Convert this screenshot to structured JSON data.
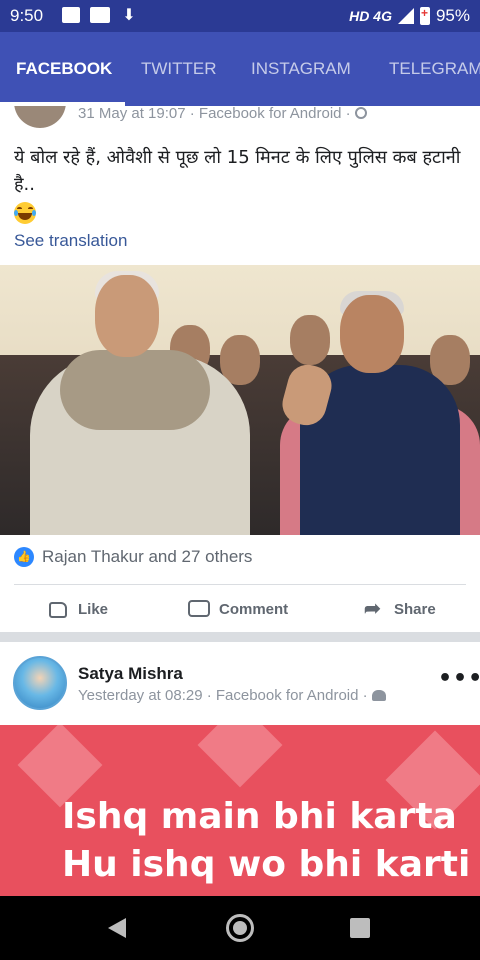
{
  "status_bar": {
    "time": "9:50",
    "network": "HD 4G",
    "battery": "95%",
    "icons": [
      "message-icon",
      "paytm-icon",
      "download-icon"
    ]
  },
  "tabs": [
    {
      "label": "FACEBOOK",
      "active": true
    },
    {
      "label": "TWITTER",
      "active": false
    },
    {
      "label": "INSTAGRAM",
      "active": false
    },
    {
      "label": "TELEGRAM",
      "active": false
    }
  ],
  "post1": {
    "meta": "31 May at 19:07 · Facebook for Android ·",
    "text": "ये बोल रहे हैं, ओवैशी से पूछ लो 15 मिनट के लिए पुलिस कब हटानी है..",
    "see_translation": "See translation",
    "reactions": "Rajan Thakur and 27 others",
    "like": "Like",
    "comment": "Comment",
    "share": "Share"
  },
  "post2": {
    "name": "Satya Mishra",
    "meta": "Yesterday at 08:29 · Facebook for Android ·",
    "banner_line1": "Ishq main bhi karta",
    "banner_line2": "Hu ishq wo bhi karti"
  },
  "colors": {
    "status_bar": "#2b3a94",
    "tab_bar": "#3f51b5",
    "link": "#385898",
    "banner": "#e8505e"
  }
}
